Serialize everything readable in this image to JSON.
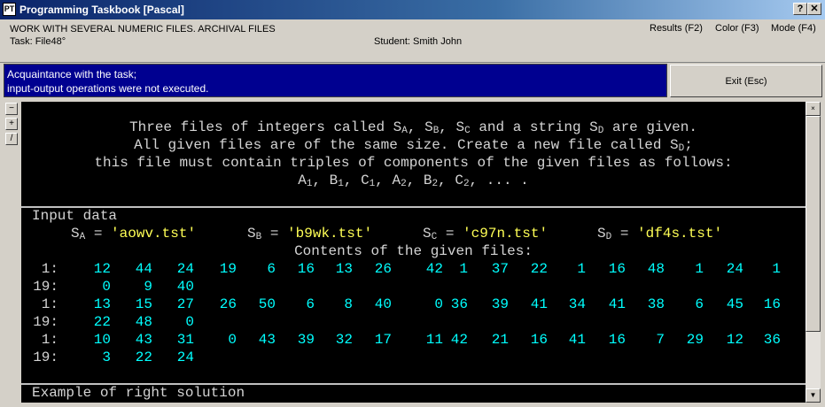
{
  "window": {
    "title": "Programming Taskbook [Pascal]",
    "icon_label": "PT",
    "help_label": "?",
    "close_label": "✕"
  },
  "header": {
    "group_title": "WORK WITH SEVERAL NUMERIC FILES. ARCHIVAL FILES",
    "task": "Task: File48°",
    "student": "Student: Smith John",
    "results": "Results (F2)",
    "color": "Color (F3)",
    "mode": "Mode (F4)"
  },
  "status": {
    "line1": "Acquaintance with the task;",
    "line2": " input-output operations were not executed."
  },
  "exit_label": "Exit (Esc)",
  "side_buttons": [
    "−",
    "+",
    "/"
  ],
  "console_close": "×",
  "task_text": {
    "l1a": "Three files of integers called S",
    "l1b": ", S",
    "l1c": ", S",
    "l1d": " and a string S",
    "l1e": " are given.",
    "l2a": "All given files are of the same size. Create a new file called S",
    "l2b": ";",
    "l3": "this file must contain triples of components of the given files as follows:",
    "l4a": "A",
    "l4b": ", B",
    "l4c": ", C",
    "l4d": ", A",
    "l4e": ", B",
    "l4f": ", C",
    "l4g": ", ... .",
    "sub_a": "A",
    "sub_b": "B",
    "sub_c": "C",
    "sub_d": "D",
    "sub_1": "1",
    "sub_2": "2"
  },
  "input_data": {
    "heading": "Input data",
    "eq": " = ",
    "files": [
      {
        "name": "S",
        "sub": "A",
        "value": "'aowv.tst'"
      },
      {
        "name": "S",
        "sub": "B",
        "value": "'b9wk.tst'"
      },
      {
        "name": "S",
        "sub": "C",
        "value": "'c97n.tst'"
      },
      {
        "name": "S",
        "sub": "D",
        "value": "'df4s.tst'"
      }
    ],
    "contents_label": "Contents of the given files:"
  },
  "file_rows": [
    {
      "prefix": "1:",
      "values": [
        "12",
        "44",
        "24",
        "19",
        "6",
        "16",
        "13",
        "26",
        "42",
        "1",
        "37",
        "22",
        "1",
        "16",
        "48",
        "1",
        "24",
        "1"
      ]
    },
    {
      "prefix": "19:",
      "values": [
        "0",
        "9",
        "40"
      ]
    },
    {
      "prefix": "1:",
      "values": [
        "13",
        "15",
        "27",
        "26",
        "50",
        "6",
        "8",
        "40",
        "0",
        "36",
        "39",
        "41",
        "34",
        "41",
        "38",
        "6",
        "45",
        "16"
      ]
    },
    {
      "prefix": "19:",
      "values": [
        "22",
        "48",
        "0"
      ]
    },
    {
      "prefix": "1:",
      "values": [
        "10",
        "43",
        "31",
        "0",
        "43",
        "39",
        "32",
        "17",
        "11",
        "42",
        "21",
        "16",
        "41",
        "16",
        "7",
        "29",
        "12",
        "36"
      ]
    },
    {
      "prefix": "19:",
      "values": [
        "3",
        "22",
        "24"
      ]
    }
  ],
  "example_heading": "Example of right solution",
  "colors": {
    "title_bar": "#0a246a",
    "status_bg": "#000090",
    "console_bg": "#000000",
    "text_white": "#d4d4d4",
    "text_yellow": "#ffff55",
    "text_cyan": "#00ffff"
  }
}
